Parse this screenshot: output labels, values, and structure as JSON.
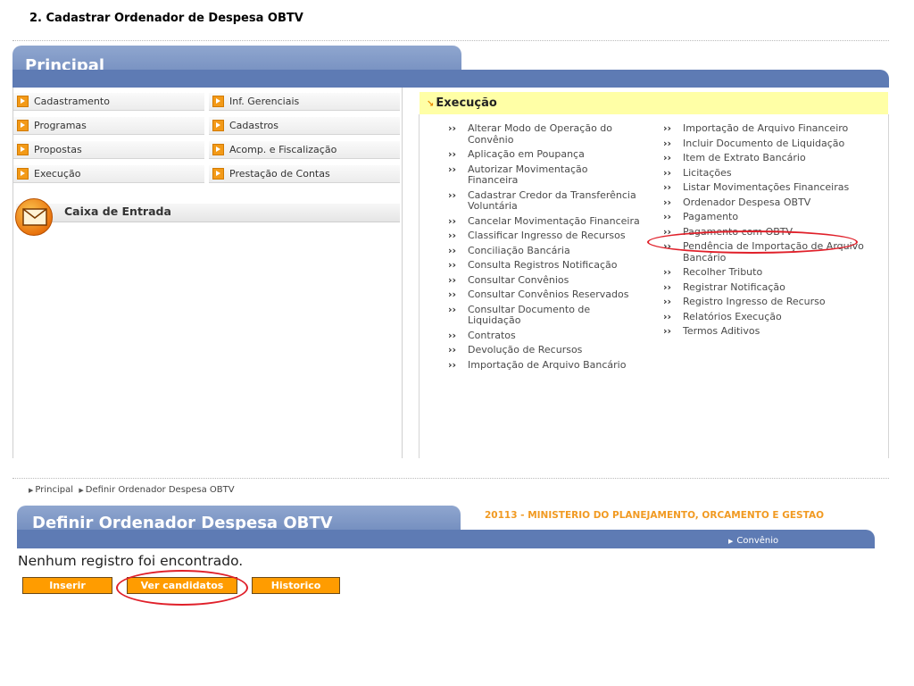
{
  "doc_title": "2. Cadastrar Ordenador de Despesa OBTV",
  "principal": {
    "title": "Principal",
    "menu_left": [
      "Cadastramento",
      "Programas",
      "Propostas",
      "Execução"
    ],
    "menu_right": [
      "Inf. Gerenciais",
      "Cadastros",
      "Acomp. e Fiscalização",
      "Prestação de Contas"
    ],
    "inbox_label": "Caixa de Entrada"
  },
  "execucao": {
    "title": "Execução",
    "bullet": "››",
    "col1": [
      "Alterar Modo de Operação do Convênio",
      "Aplicação em Poupança",
      "Autorizar Movimentação Financeira",
      "Cadastrar Credor da Transferência Voluntária",
      "Cancelar Movimentação Financeira",
      "Classificar Ingresso de Recursos",
      "Conciliação Bancária",
      "Consulta Registros Notificação",
      "Consultar Convênios",
      "Consultar Convênios Reservados",
      "Consultar Documento de Liquidação",
      "Contratos",
      "Devolução de Recursos",
      "Importação de Arquivo Bancário"
    ],
    "col2": [
      "Importação de Arquivo Financeiro",
      "Incluir Documento de Liquidação",
      "Item de Extrato Bancário",
      "Licitações",
      "Listar Movimentações Financeiras",
      "Ordenador Despesa OBTV",
      "Pagamento",
      "Pagamento com OBTV",
      "Pendência de Importação de Arquivo Bancário",
      "Recolher Tributo",
      "Registrar Notificação",
      "Registro Ingresso de Recurso",
      "Relatórios Execução",
      "Termos Aditivos"
    ]
  },
  "breadcrumb": [
    "Principal",
    "Definir Ordenador Despesa OBTV"
  ],
  "definir": {
    "title": "Definir Ordenador Despesa OBTV",
    "ministry": "20113 - MINISTERIO DO PLANEJAMENTO, ORCAMENTO E GESTAO",
    "convenio_link": "Convênio",
    "empty_message": "Nenhum registro foi encontrado.",
    "buttons": {
      "insert": "Inserir",
      "candidates": "Ver candidatos",
      "history": "Historico"
    }
  },
  "colors": {
    "header_blue": "#5e7bb4",
    "tab_blue": "#7f97c7",
    "orange": "#ff9c00",
    "highlight_red": "#e0202a",
    "exec_yellow": "#ffffa6"
  }
}
